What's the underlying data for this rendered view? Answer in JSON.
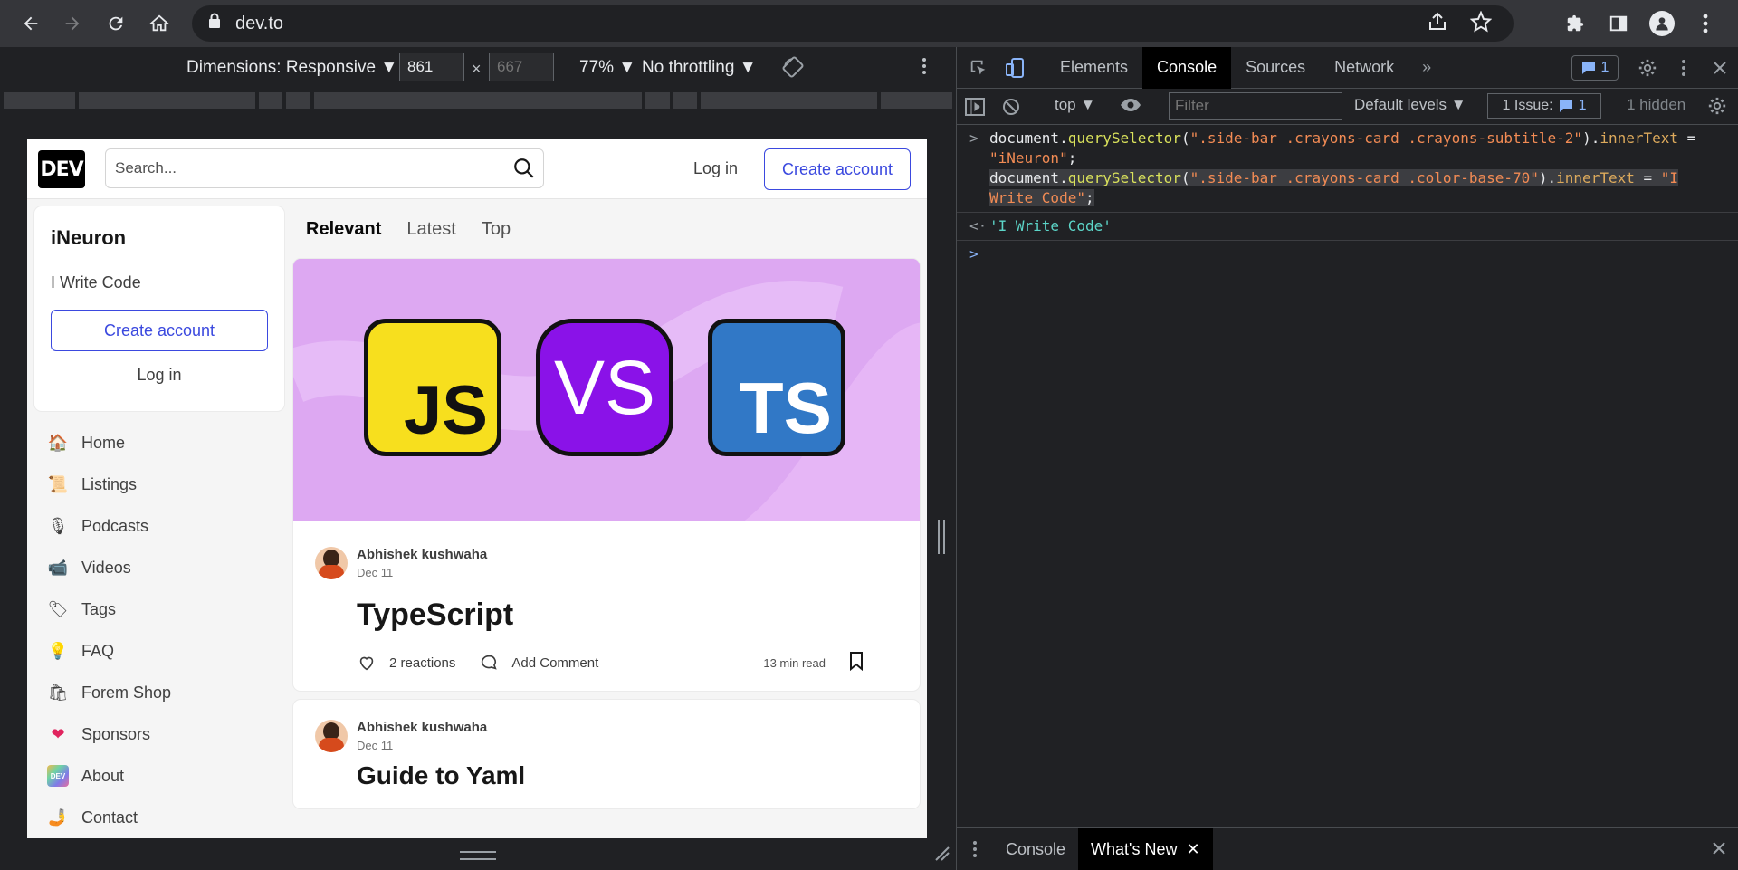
{
  "browser": {
    "url": "dev.to"
  },
  "device_toolbar": {
    "dimensions_label": "Dimensions: Responsive",
    "width_value": "861",
    "height_placeholder": "667",
    "zoom": "77%",
    "throttling": "No throttling"
  },
  "site": {
    "logo": "DEV",
    "search_placeholder": "Search...",
    "login": "Log in",
    "create_account": "Create account"
  },
  "sidecard": {
    "title": "iNeuron",
    "subtitle": "I Write Code",
    "create_account": "Create account",
    "login": "Log in"
  },
  "sidenav": [
    {
      "label": "Home",
      "icon": "🏠"
    },
    {
      "label": "Listings",
      "icon": "📜"
    },
    {
      "label": "Podcasts",
      "icon": "🎙"
    },
    {
      "label": "Videos",
      "icon": "📹"
    },
    {
      "label": "Tags",
      "icon": "🏷"
    },
    {
      "label": "FAQ",
      "icon": "💡"
    },
    {
      "label": "Forem Shop",
      "icon": "🛍"
    },
    {
      "label": "Sponsors",
      "icon": "❤"
    },
    {
      "label": "About",
      "icon": "DEV"
    },
    {
      "label": "Contact",
      "icon": "🤳"
    }
  ],
  "feed": {
    "tabs": [
      "Relevant",
      "Latest",
      "Top"
    ],
    "cover": {
      "js": "JS",
      "vs": "VS",
      "ts": "TS"
    },
    "posts": [
      {
        "author": "Abhishek kushwaha",
        "date": "Dec 11",
        "title": "TypeScript",
        "reactions": "2 reactions",
        "comment": "Add Comment",
        "read_time": "13 min read"
      },
      {
        "author": "Abhishek kushwaha",
        "date": "Dec 11",
        "title": "Guide to Yaml"
      }
    ]
  },
  "devtools": {
    "tabs": [
      "Elements",
      "Console",
      "Sources",
      "Network"
    ],
    "active_tab": "Console",
    "message_count": "1",
    "context": "top",
    "filter_placeholder": "Filter",
    "levels": "Default levels",
    "issues_label": "1 Issue:",
    "issues_count": "1",
    "hidden": "1 hidden",
    "console": {
      "line1_a": "document",
      "line1_b": ".",
      "line1_c": "querySelector",
      "line1_d": "(",
      "line1_e": "\".side-bar .crayons-card .crayons-subtitle-2\"",
      "line1_f": ").",
      "line1_g": "innerText",
      "line1_h": " = ",
      "line1_i": "\"iNeuron\"",
      "line1_j": ";",
      "line2_a": "document",
      "line2_b": ".",
      "line2_c": "querySelector",
      "line2_d": "(",
      "line2_e": "\".side-bar .crayons-card .color-base-70\"",
      "line2_f": ").",
      "line2_g": "innerText",
      "line2_h": " = ",
      "line2_i": "\"I Write Code\"",
      "line2_j": ";",
      "result": "'I Write Code'"
    },
    "drawer_tabs": [
      "Console",
      "What's New"
    ]
  },
  "colors": {
    "accent": "#3b49df",
    "console_string": "#f28b54",
    "console_function": "#d9e15b",
    "console_result": "#5cd5c8"
  }
}
